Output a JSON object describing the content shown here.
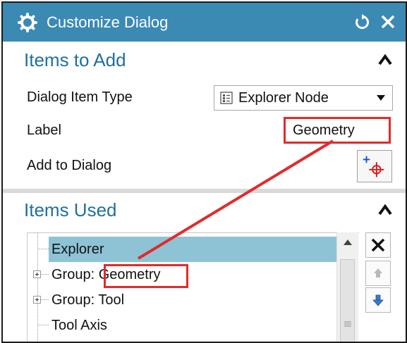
{
  "dialog": {
    "title": "Customize Dialog",
    "icons": {
      "app": "gear-icon",
      "reset": "reset-icon",
      "close": "close-icon"
    },
    "colors": {
      "titlebar": "#3b8ab4",
      "section_title": "#1f6fa0",
      "highlight": "#e32a2a",
      "selection": "#8ec3d6"
    }
  },
  "items_to_add": {
    "title": "Items to Add",
    "dialog_item_type": {
      "label": "Dialog Item Type",
      "value": "Explorer Node",
      "icon": "explorer-node-icon"
    },
    "label_field": {
      "label": "Label",
      "value": "Geometry"
    },
    "add_to_dialog": {
      "label": "Add to Dialog",
      "icon": "add-point-icon"
    }
  },
  "items_used": {
    "title": "Items Used",
    "tree": [
      {
        "prefix": "",
        "name": "Explorer",
        "selected": true,
        "expandable": false
      },
      {
        "prefix": "Group: ",
        "name": "Geometry",
        "selected": false,
        "expandable": true
      },
      {
        "prefix": "Group: ",
        "name": "Tool",
        "selected": false,
        "expandable": true
      },
      {
        "prefix": "",
        "name": "Tool Axis",
        "selected": false,
        "expandable": false
      }
    ],
    "buttons": {
      "remove": "remove-icon",
      "move_up": "move-up-icon",
      "move_down": "move-down-icon"
    }
  }
}
